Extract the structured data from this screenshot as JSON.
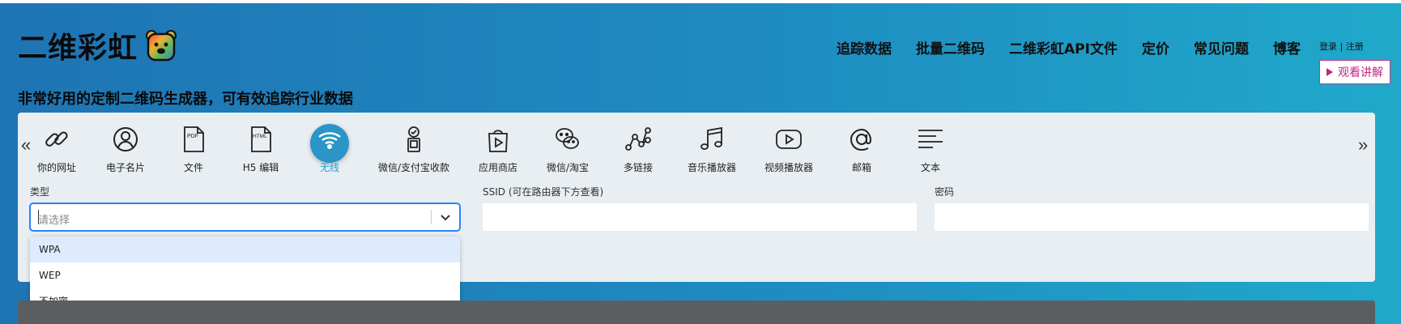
{
  "brand": {
    "name": "二维彩虹"
  },
  "tagline": "非常好用的定制二维码生成器，可有效追踪行业数据",
  "nav": [
    "追踪数据",
    "批量二维码",
    "二维彩虹API文件",
    "定价",
    "常见问题",
    "博客"
  ],
  "auth": "登录 | 注册",
  "watch_label": "观看讲解",
  "types": [
    {
      "label": "你的网址",
      "icon": "link-icon"
    },
    {
      "label": "电子名片",
      "icon": "person-icon"
    },
    {
      "label": "文件",
      "icon": "pdf-file-icon"
    },
    {
      "label": "H5 编辑",
      "icon": "html-file-icon"
    },
    {
      "label": "无线",
      "icon": "wifi-icon",
      "active": true
    },
    {
      "label": "微信/支付宝收款",
      "icon": "payment-icon"
    },
    {
      "label": "应用商店",
      "icon": "app-store-icon"
    },
    {
      "label": "微信/淘宝",
      "icon": "wechat-icon"
    },
    {
      "label": "多链接",
      "icon": "multi-link-icon"
    },
    {
      "label": "音乐播放器",
      "icon": "music-icon"
    },
    {
      "label": "视频播放器",
      "icon": "video-icon"
    },
    {
      "label": "邮箱",
      "icon": "email-icon"
    },
    {
      "label": "文本",
      "icon": "text-icon"
    }
  ],
  "form": {
    "type_label": "类型",
    "type_placeholder": "请选择",
    "ssid_label": "SSID (可在路由器下方查看)",
    "password_label": "密码",
    "options": [
      "WPA",
      "WEP",
      "不加密"
    ]
  },
  "colors": {
    "accent": "#2a95c6",
    "brand_pink": "#c0287f",
    "focus": "#2684ff"
  }
}
